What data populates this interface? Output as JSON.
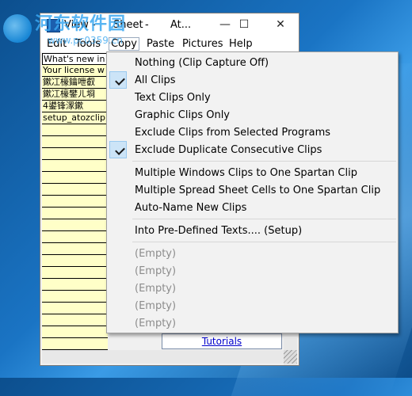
{
  "window": {
    "title_segments": [
      "View - ",
      "Sheet",
      " - ",
      "At..."
    ],
    "controls": {
      "minimize": "—",
      "maximize": "☐",
      "close": "✕"
    }
  },
  "menubar": {
    "items": [
      "Edit",
      "Tools",
      "Copy",
      "Paste",
      "Pictures",
      "Help"
    ],
    "active": "Copy"
  },
  "sheet": {
    "rows": [
      "What's new in",
      "Your license w",
      "鏉冮檺鑰呭叡",
      "鏉冮檺鐢ㄦ埛",
      "4鍙锋潈鏉",
      "setup_atozclip",
      "",
      "",
      "",
      "",
      "",
      "",
      "",
      "",
      "",
      "",
      "",
      "",
      "",
      "",
      "",
      "",
      "",
      "",
      ""
    ]
  },
  "right_panel": {
    "link": "Tutorials"
  },
  "copy_menu": {
    "items": [
      {
        "label": "Nothing (Clip Capture Off)",
        "checked": false,
        "disabled": false
      },
      {
        "label": "All Clips",
        "checked": true,
        "disabled": false
      },
      {
        "label": "Text Clips Only",
        "checked": false,
        "disabled": false
      },
      {
        "label": "Graphic Clips Only",
        "checked": false,
        "disabled": false
      },
      {
        "label": "Exclude Clips from Selected Programs",
        "checked": false,
        "disabled": false
      },
      {
        "label": "Exclude Duplicate Consecutive Clips",
        "checked": true,
        "disabled": false
      },
      {
        "label": "Multiple Windows Clips to One Spartan Clip",
        "checked": false,
        "disabled": false
      },
      {
        "label": "Multiple Spread Sheet Cells to One Spartan Clip",
        "checked": false,
        "disabled": false
      },
      {
        "label": "Auto-Name New Clips",
        "checked": false,
        "disabled": false
      },
      {
        "label": "Into Pre-Defined Texts.... (Setup)",
        "checked": false,
        "disabled": false
      },
      {
        "label": "(Empty)",
        "checked": false,
        "disabled": true
      },
      {
        "label": "(Empty)",
        "checked": false,
        "disabled": true
      },
      {
        "label": "(Empty)",
        "checked": false,
        "disabled": true
      },
      {
        "label": "(Empty)",
        "checked": false,
        "disabled": true
      },
      {
        "label": "(Empty)",
        "checked": false,
        "disabled": true
      }
    ]
  },
  "watermark": {
    "text": "河东软件园",
    "url": "www.pc0359.cn"
  }
}
